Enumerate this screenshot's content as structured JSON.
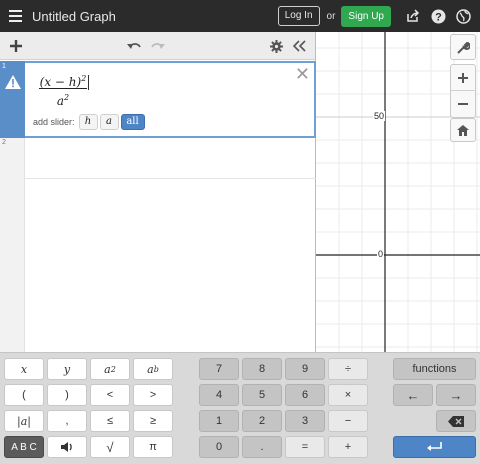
{
  "header": {
    "title": "Untitled Graph",
    "login_label": "Log In",
    "or_label": "or",
    "signup_label": "Sign Up",
    "icons": [
      "menu-icon",
      "share-icon",
      "help-icon",
      "globe-icon"
    ]
  },
  "expressions": {
    "rows": [
      {
        "index": "1",
        "numerator": "(x − h)",
        "numerator_exponent": "2",
        "denominator": "a",
        "denominator_exponent": "2",
        "status_icon": "warning-icon"
      },
      {
        "index": "2"
      }
    ],
    "slider_label": "add slider:",
    "slider_options": [
      "h",
      "a",
      "all"
    ]
  },
  "graph": {
    "y_label_50": "50",
    "origin_label": "0"
  },
  "keypad": {
    "functions_label": "functions",
    "abc_label": "A B C",
    "keys": {
      "x": "x",
      "y": "y",
      "a2": "a",
      "a2_exp": "2",
      "ab": "a",
      "ab_exp": "b",
      "lparen": "(",
      "rparen": ")",
      "lt": "<",
      "gt": ">",
      "abs": "|a|",
      "comma": ",",
      "le": "≤",
      "ge": "≥",
      "sqrt": "√",
      "pi": "π",
      "n7": "7",
      "n8": "8",
      "n9": "9",
      "div": "÷",
      "n4": "4",
      "n5": "5",
      "n6": "6",
      "mul": "×",
      "n1": "1",
      "n2": "2",
      "n3": "3",
      "minus": "−",
      "n0": "0",
      "dot": ".",
      "eq": "=",
      "plus": "+",
      "left": "←",
      "right": "→"
    }
  },
  "colors": {
    "header_bg": "#2b2b2b",
    "signup_green": "#2fa84f",
    "accent_blue": "#4e85c6",
    "curve_red": "#c0392b"
  }
}
